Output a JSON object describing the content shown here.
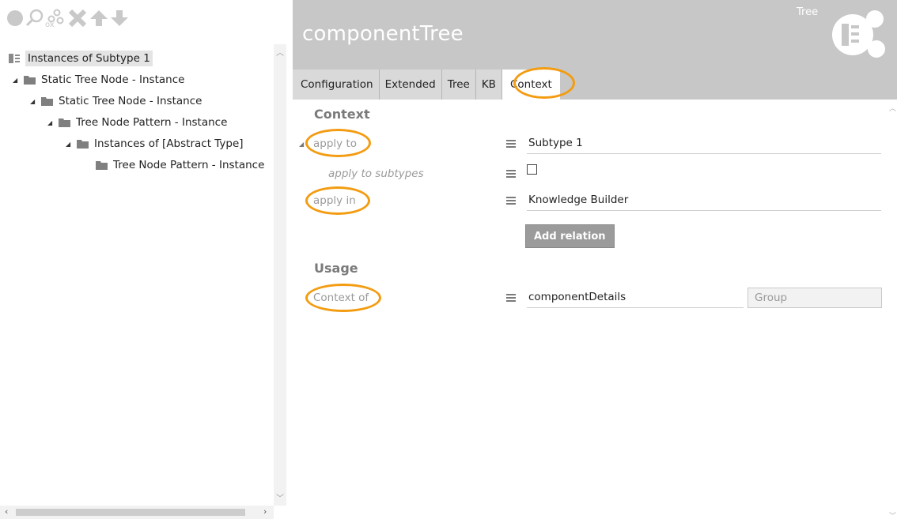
{
  "toolbar": {
    "icons": [
      "circle-icon",
      "search-icon",
      "hierarchy-icon",
      "delete-icon",
      "arrow-up-icon",
      "arrow-down-icon"
    ]
  },
  "tree": {
    "root": "Instances of Subtype 1",
    "nodes": [
      {
        "label": "Static Tree Node - Instance"
      },
      {
        "label": "Static Tree Node - Instance"
      },
      {
        "label": "Tree Node Pattern - Instance"
      },
      {
        "label": "Instances of [Abstract Type]"
      },
      {
        "label": "Tree Node Pattern - Instance"
      }
    ]
  },
  "header": {
    "title": "componentTree",
    "type_label": "Tree"
  },
  "tabs": [
    "Configuration",
    "Extended",
    "Tree",
    "KB",
    "Context"
  ],
  "content": {
    "context_section": "Context",
    "apply_to_label": "apply to",
    "apply_to_value": "Subtype 1",
    "apply_to_subtypes_label": "apply to subtypes",
    "apply_in_label": "apply in",
    "apply_in_value": "Knowledge Builder",
    "add_relation_label": "Add relation",
    "usage_section": "Usage",
    "context_of_label": "Context of",
    "context_of_value": "componentDetails",
    "group_placeholder": "Group"
  },
  "colors": {
    "header_bg": "#c7c7c7",
    "highlight_ring": "#f39c12",
    "toolbar_icon": "#c9c9c9"
  }
}
